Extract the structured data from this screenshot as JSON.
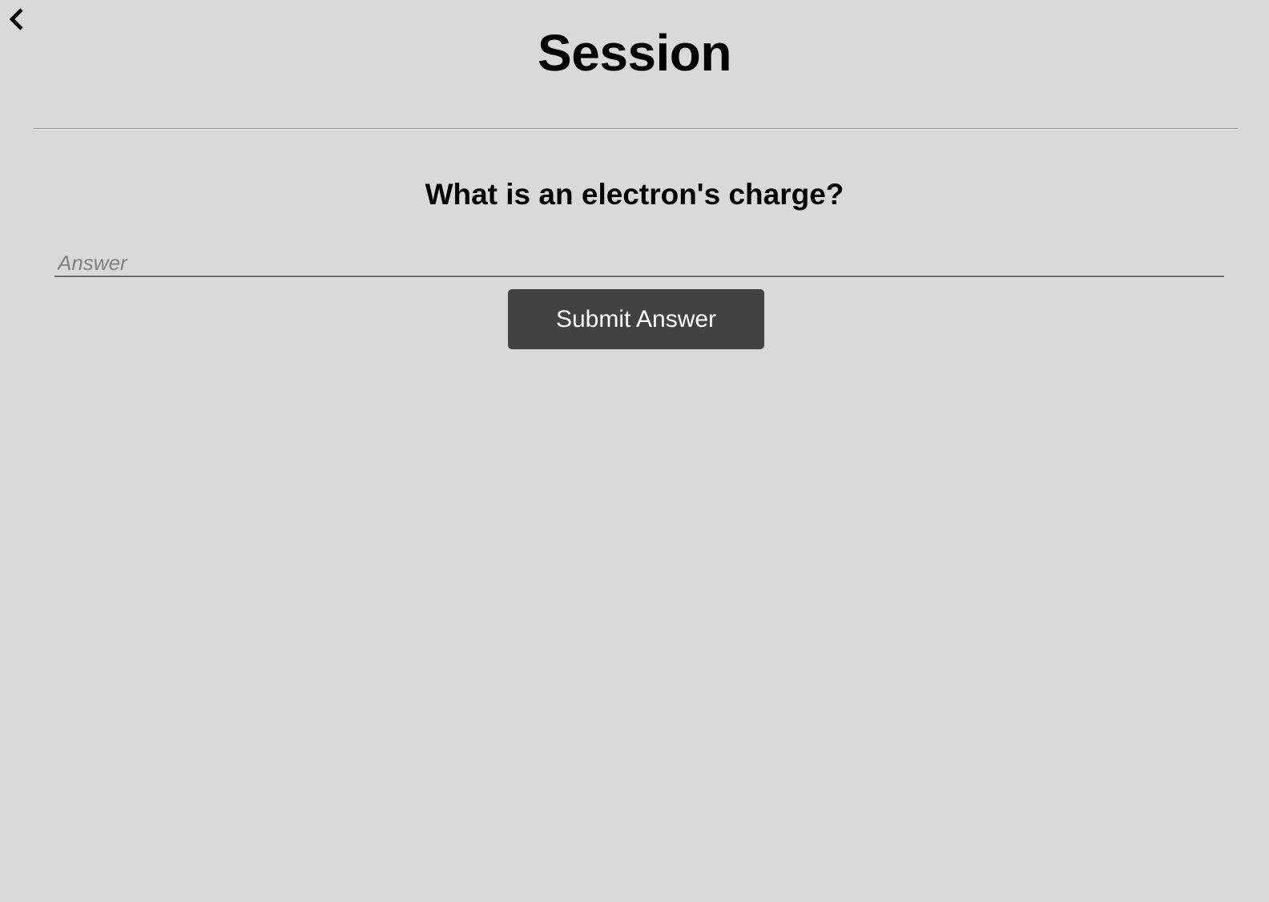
{
  "header": {
    "back_icon": "chevron-left-icon",
    "title": "Session"
  },
  "question": {
    "text": "What is an electron's charge?"
  },
  "answer": {
    "value": "",
    "placeholder": "Answer"
  },
  "submit": {
    "label": "Submit Answer"
  },
  "colors": {
    "background": "#d9d9d9",
    "button": "#424242",
    "button_text": "#ffffff",
    "placeholder": "#808080"
  }
}
